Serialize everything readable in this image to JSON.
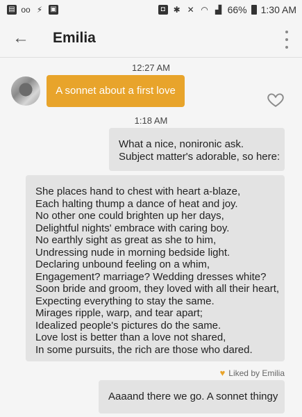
{
  "status_bar": {
    "left_icons": [
      "message-icon",
      "voicemail-icon",
      "bolt-icon",
      "image-icon"
    ],
    "right_icons": [
      "lock-icon",
      "bluetooth-icon",
      "mute-icon",
      "wifi-icon",
      "signal-icon",
      "battery-icon"
    ],
    "battery": "66%",
    "time": "1:30 AM"
  },
  "header": {
    "title": "Emilia"
  },
  "messages": {
    "ts1": "12:27 AM",
    "user_text": "A sonnet about a first love",
    "ts2": "1:18 AM",
    "reply1": [
      "What a nice, nonironic ask.",
      "Subject matter's adorable, so here:"
    ],
    "sonnet": [
      "She places hand to chest with heart a-blaze,",
      "Each halting thump a dance of heat and joy.",
      "No other one could brighten up her days,",
      "Delightful nights' embrace with caring boy.",
      "No earthly sight as great as she to him,",
      "Undressing nude in morning bedside light.",
      "Declaring unbound feeling on a whim,",
      "Engagement? marriage? Wedding dresses white?",
      "Soon bride and groom, they loved with all their heart,",
      "Expecting everything to stay the same.",
      "Mirages ripple, warp, and tear apart;",
      "Idealized people's pictures do the same.",
      "Love lost is better than a love not shared,",
      "In some pursuits, the rich are those who dared."
    ],
    "liked_label": "Liked by Emilia",
    "reply2": "Aaaand there we go. A sonnet thingy"
  },
  "colors": {
    "accent": "#e8a42b",
    "bot_bubble": "#e3e3e3",
    "background": "#f5f5f5"
  }
}
